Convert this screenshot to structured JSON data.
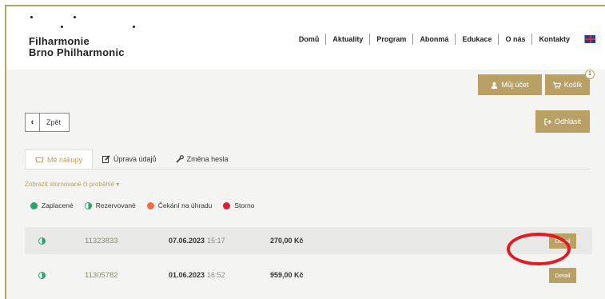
{
  "logo": {
    "line1": "Filharmonie",
    "line2": "Brno Philharmonic"
  },
  "nav": [
    "Domů",
    "Aktuality",
    "Program",
    "Abonmá",
    "Edukace",
    "O nás",
    "Kontakty"
  ],
  "account": {
    "label": "Můj účet",
    "cart_label": "Košík",
    "cart_count": "1",
    "logout_label": "Odhlásit"
  },
  "back_label": "Zpět",
  "tabs": [
    {
      "label": "Mé nákupy",
      "icon": "cart-icon"
    },
    {
      "label": "Úprava údajů",
      "icon": "edit-icon"
    },
    {
      "label": "Změna hesla",
      "icon": "wrench-icon"
    }
  ],
  "filter_label": "Zobrazit stornované či proběhlé",
  "legend": [
    {
      "label": "Zaplacené",
      "color": "#2aa36a"
    },
    {
      "label": "Rezervované",
      "color": "#2aa36a"
    },
    {
      "label": "Čekání na úhradu",
      "color": "#ee6b45"
    },
    {
      "label": "Storno",
      "color": "#e01b3a"
    }
  ],
  "orders": [
    {
      "id": "11323833",
      "date": "07.06.2023",
      "time": "15:17",
      "price": "270,00 Kč",
      "detail": "Detail"
    },
    {
      "id": "11305782",
      "date": "01.06.2023",
      "time": "16:52",
      "price": "959,00 Kč",
      "detail": "Detail"
    }
  ],
  "colors": {
    "gold": "#b9a165",
    "highlight": "#e01b24"
  }
}
